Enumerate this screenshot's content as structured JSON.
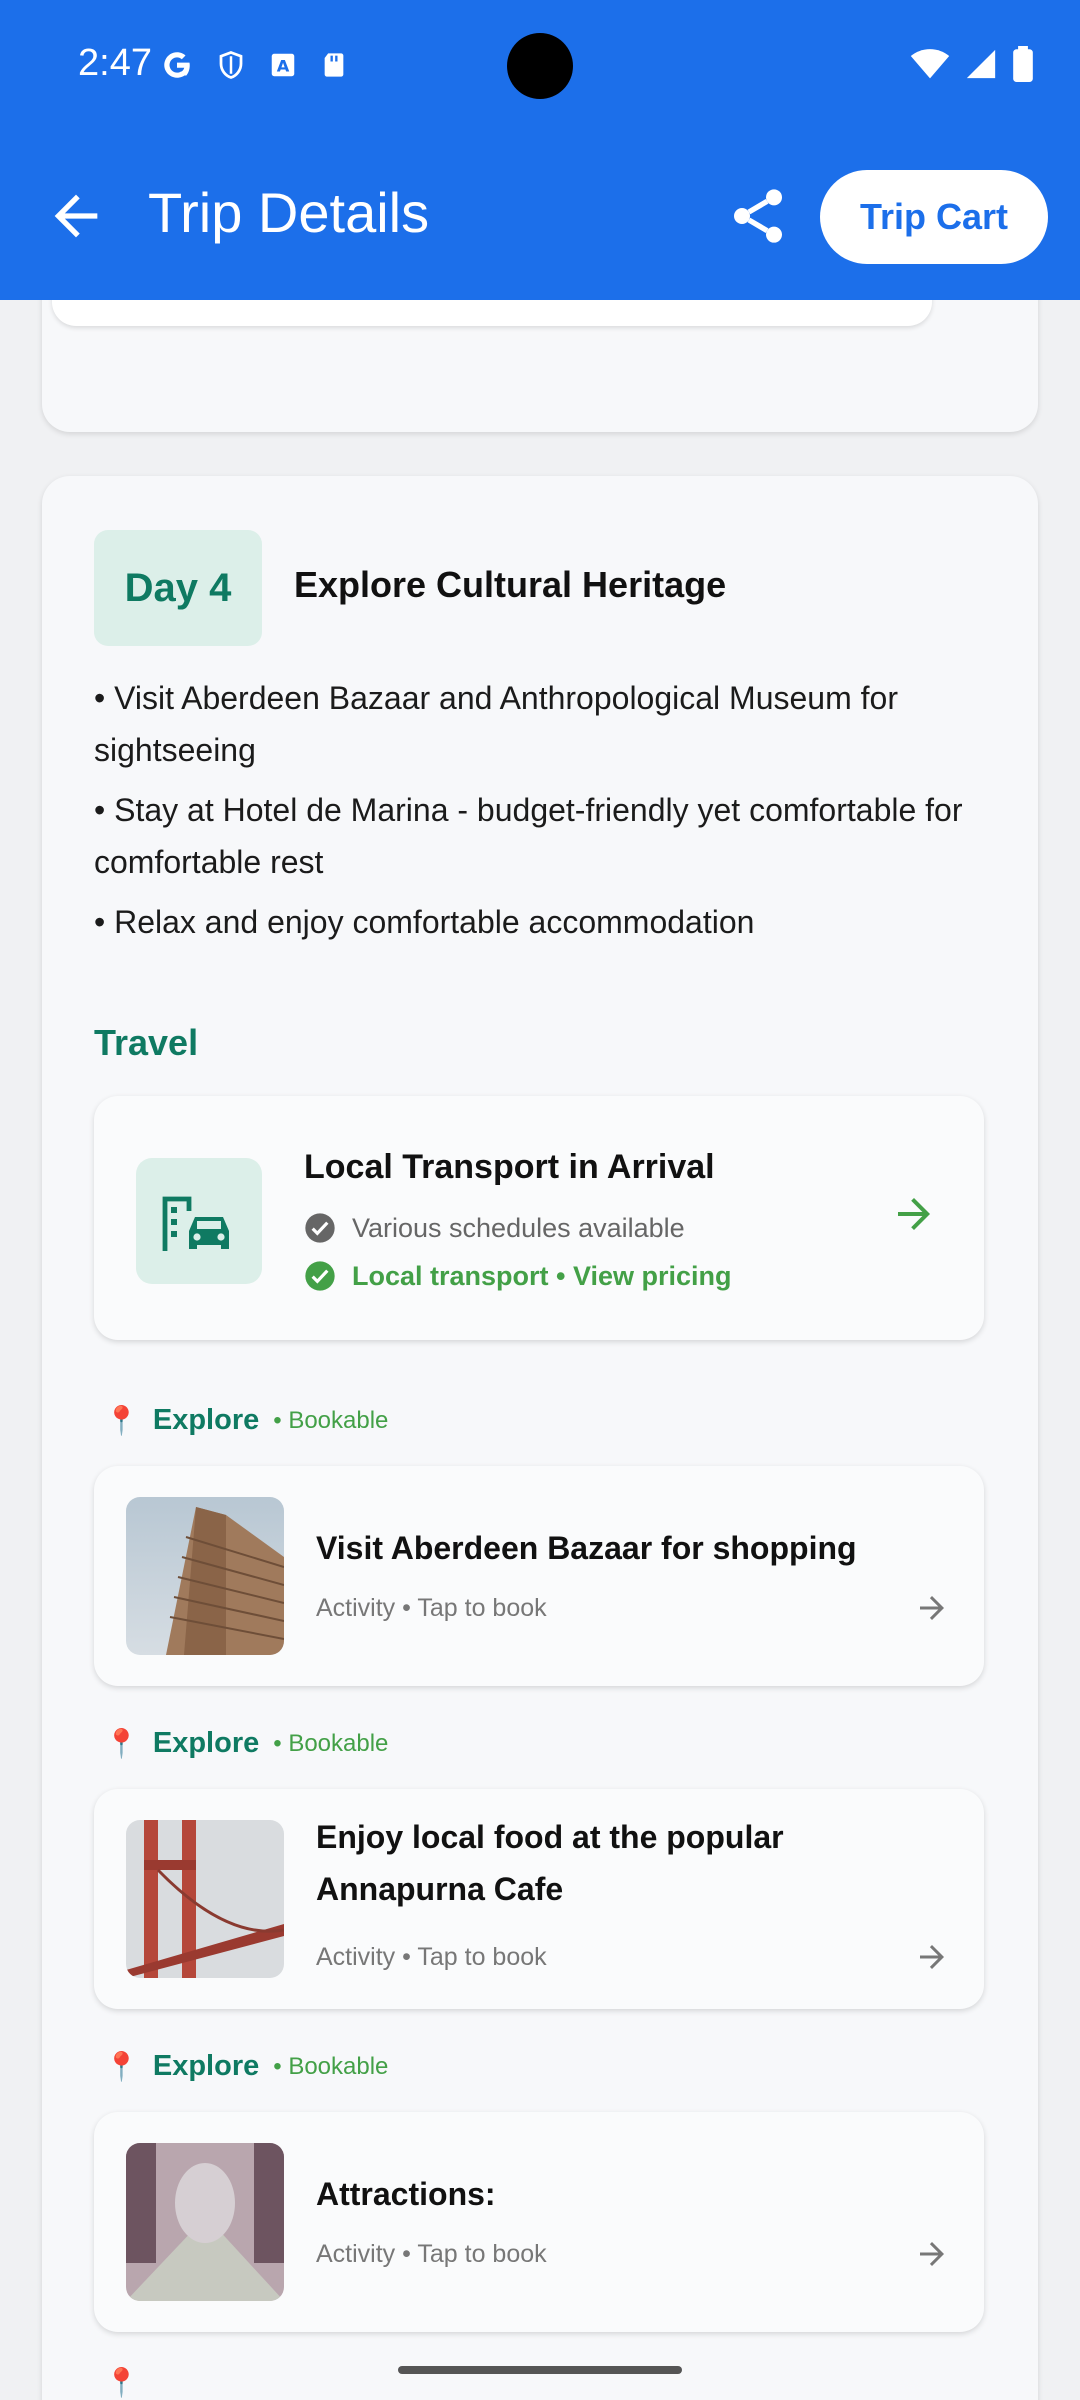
{
  "status": {
    "time": "2:47"
  },
  "appbar": {
    "title": "Trip Details",
    "cart_label": "Trip Cart"
  },
  "day": {
    "badge": "Day 4",
    "title": "Explore Cultural Heritage",
    "bullets": [
      "• Visit Aberdeen Bazaar and Anthropological Museum for sightseeing",
      "• Stay at Hotel de Marina - budget-friendly yet comfortable for comfortable rest",
      "• Relax and enjoy comfortable accommodation"
    ],
    "travel_heading": "Travel"
  },
  "transport": {
    "title": "Local Transport in Arrival",
    "schedule": "Various schedules available",
    "pricing": "Local transport • View pricing"
  },
  "explore_labels": {
    "explore": "Explore",
    "bookable": "• Bookable"
  },
  "activities": [
    {
      "title": "Visit Aberdeen Bazaar for shopping",
      "subtitle": "Activity • Tap to book"
    },
    {
      "title": "Enjoy local food at the popular Annapurna Cafe",
      "subtitle": "Activity • Tap to book"
    },
    {
      "title": "Attractions:",
      "subtitle": "Activity • Tap to book"
    }
  ],
  "colors": {
    "primary": "#1c6fea",
    "teal": "#0f7a62",
    "green": "#43a047"
  },
  "icons": [
    "back-arrow-icon",
    "share-icon",
    "transport-icon",
    "check-icon",
    "arrow-right-icon",
    "pin-icon"
  ]
}
